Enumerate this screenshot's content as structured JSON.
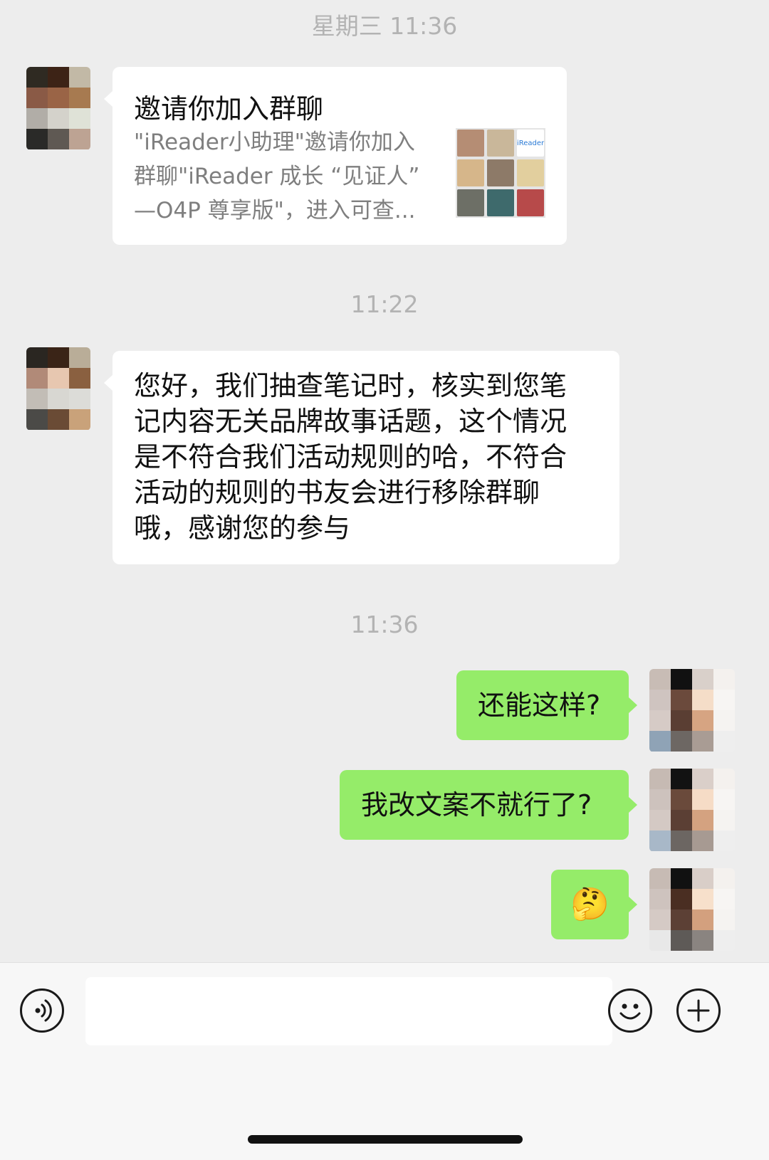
{
  "timestamps": {
    "top": "星期三 11:36",
    "middle": "11:22",
    "lower": "11:36"
  },
  "messages": {
    "invite_card": {
      "title": "邀请你加入群聊",
      "desc_lines": [
        "\"iReader小助理\"邀请你加入",
        "群聊\"iReader 成长 “见证人”",
        "—O4P 尊享版\"，进入可查..."
      ],
      "thumbnail_brand": "iReader"
    },
    "notice": {
      "lines": [
        "您好，我们抽查笔记时，核实到您笔",
        "记内容无关品牌故事话题，这个情况",
        "是不符合我们活动规则的哈，不符合",
        "活动的规则的书友会进行移除群聊",
        "哦，感谢您的参与"
      ]
    },
    "reply_1": "还能这样?",
    "reply_2": "我改文案不就行了?",
    "reply_3_emoji": "🤔"
  },
  "input_bar": {
    "voice_icon": "voice-wave-icon",
    "emoji_icon": "smiley-icon",
    "plus_icon": "plus-icon"
  },
  "colors": {
    "background": "#ededed",
    "bubble_self": "#95ec69",
    "bubble_other": "#ffffff",
    "timestamp": "#b3b3b3"
  }
}
